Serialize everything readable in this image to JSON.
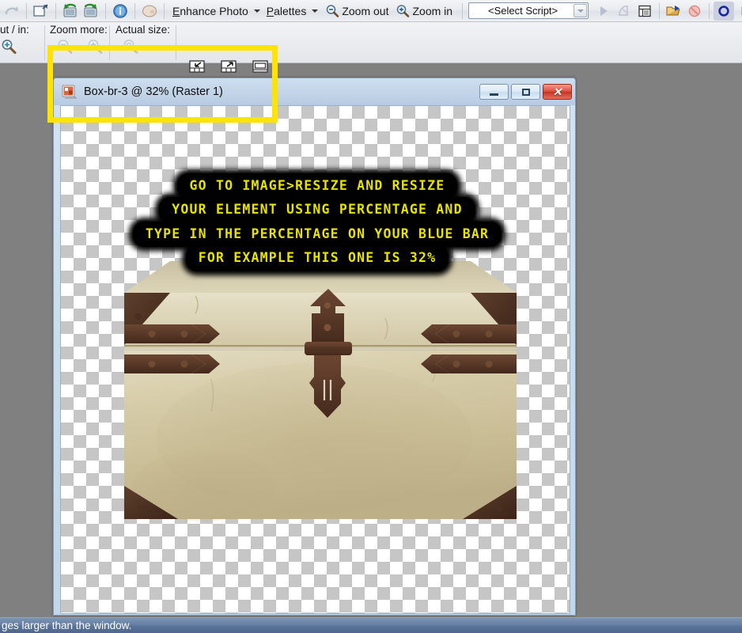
{
  "app": {
    "background_color": "#808080",
    "accent_highlight_color": "#ffe400"
  },
  "toolbar": {
    "icons_left": [
      {
        "name": "redo-icon",
        "title": "Redo"
      },
      {
        "name": "crop-icon",
        "title": "Crop"
      },
      {
        "name": "rotate-left-icon",
        "title": "Rotate Left"
      },
      {
        "name": "rotate-right-icon",
        "title": "Rotate Right"
      },
      {
        "name": "info-icon",
        "title": "Image Information"
      },
      {
        "name": "palette-icon",
        "title": "Materials"
      }
    ],
    "menus": [
      {
        "label": "Enhance Photo",
        "accel": "E",
        "has_caret": true
      },
      {
        "label": "Palettes",
        "accel": "P",
        "has_caret": true
      }
    ],
    "zoom_out_label": "Zoom out",
    "zoom_in_label": "Zoom in",
    "script_select_value": "<Select Script>",
    "icons_right": [
      {
        "name": "run-script-icon",
        "title": "Run Selected Script"
      },
      {
        "name": "edit-script-icon",
        "title": "Edit Selected Script"
      },
      {
        "name": "script-editor-icon",
        "title": "Script Editor"
      },
      {
        "name": "open-script-icon",
        "title": "Open Script"
      },
      {
        "name": "stop-script-icon",
        "title": "Stop Script"
      },
      {
        "name": "record-script-icon",
        "title": "Start Script Recording"
      },
      {
        "name": "pause-script-icon",
        "title": "Pause Script Recording"
      },
      {
        "name": "cancel-script-icon",
        "title": "Cancel Script Recording"
      }
    ]
  },
  "toolbar_row2": {
    "group_zoom_out_in": "ut / in:",
    "group_zoom_more": "Zoom more:",
    "group_actual_size": "Actual size:",
    "icons": [
      {
        "name": "zoom-in-magnifier-icon"
      },
      {
        "name": "zoom-more-out-icon"
      },
      {
        "name": "zoom-more-in-icon"
      },
      {
        "name": "actual-size-icon"
      },
      {
        "name": "fit-to-window-icon"
      },
      {
        "name": "fit-image-to-window-icon"
      },
      {
        "name": "full-screen-preview-icon"
      }
    ]
  },
  "document_window": {
    "title": "Box-br-3 @  32% (Raster 1)",
    "icon_name": "image-document-icon",
    "controls": {
      "minimize_label": "Minimize",
      "maximize_label": "Maximize",
      "close_label": "Close",
      "close_glyph": "✕"
    },
    "zoom_percent": "32%",
    "layer_name": "Raster 1",
    "file_name": "Box-br-3"
  },
  "canvas": {
    "transparency_checker": true,
    "checker_light": "#ffffff",
    "checker_dark": "#c6c6c6",
    "image_subject": "treasure-chest"
  },
  "overlay_text": {
    "color": "#e8e400",
    "background": "#000000",
    "lines": [
      "GO  TO  IMAGE>RESIZE  AND  RESIZE",
      "YOUR  ELEMENT  USING  PERCENTAGE  AND",
      "TYPE  IN  THE  PERCENTAGE  ON  YOUR  BLUE  BAR",
      "FOR  EXAMPLE  THIS  ONE  IS  32%"
    ]
  },
  "status_bar": {
    "text": "ges larger than the window."
  }
}
